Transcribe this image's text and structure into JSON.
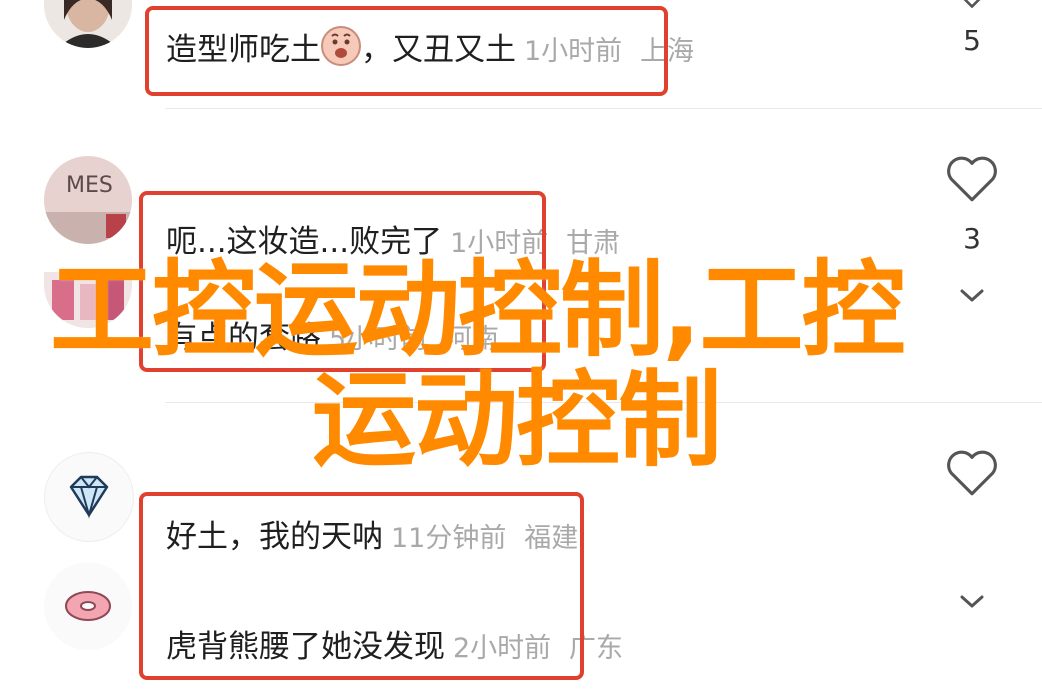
{
  "comments": [
    {
      "text": "造型师吃土",
      "emoji": "crying-face-emoji",
      "suffix": "，又丑又土",
      "time": "1小时前",
      "location": "上海",
      "likes": "5"
    },
    {
      "text": "呃...这妆造...败完了",
      "time": "1小时前",
      "location": "甘肃",
      "likes": "3"
    },
    {
      "text": "有点的套路",
      "time": "5小时前",
      "location": "河南"
    },
    {
      "text": "好土，我的天呐",
      "time": "11分钟前",
      "location": "福建"
    },
    {
      "text": "虎背熊腰了她没发现",
      "time": "2小时前",
      "location": "广东"
    }
  ],
  "overlay": {
    "line1": "工控运动控制,工控",
    "line2": "运动控制"
  },
  "avatars": {
    "avatar2_text": "MES"
  },
  "colors": {
    "highlight_box": "#e0412f",
    "overlay_text": "#ff8a00",
    "meta_text": "#a9a9a9"
  }
}
